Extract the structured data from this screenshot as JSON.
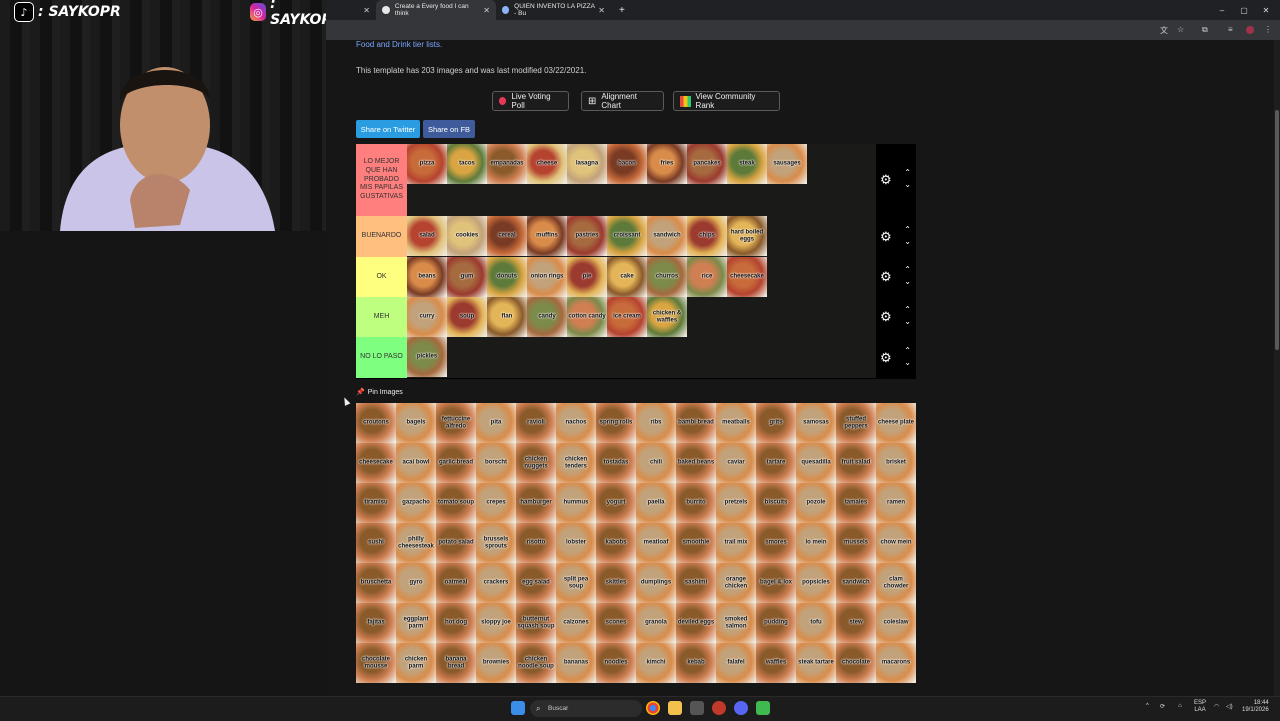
{
  "overlay": {
    "tiktok_handle": ": SAYKOPR",
    "instagram_handle": ": SAYKOPR"
  },
  "browser": {
    "tabs": [
      {
        "title": "Create a Every food I can think",
        "active": true
      },
      {
        "title": "QUIEN INVENTO LA PIZZA - Bu",
        "active": false
      }
    ],
    "new_tab": "+",
    "window_controls": [
      "–",
      "▢",
      "✕"
    ]
  },
  "page": {
    "link_line": "Food and Drink tier lists.",
    "info": "This template has 203 images and was last modified 03/22/2021.",
    "buttons": {
      "live_voting": "Live Voting Poll",
      "alignment": "Alignment Chart",
      "community": "View Community Rank"
    },
    "share_twitter": "Share on Twitter",
    "share_fb": "Share on FB",
    "pin_images": "Pin Images"
  },
  "tiers": [
    {
      "label": "LO MEJOR QUE HAN PROBADO MIS PAPILAS GUSTATIVAS",
      "color": "#ff7f7f",
      "items": [
        "pizza",
        "tacos",
        "empanadas",
        "cheese",
        "lasagna",
        "bacon",
        "fries",
        "pancakes",
        "steak",
        "sausages"
      ]
    },
    {
      "label": "BUENARDO",
      "color": "#ffbf7f",
      "items": [
        "salad",
        "cookies",
        "cereal",
        "muffins",
        "pastries",
        "croissant",
        "sandwich",
        "chips",
        "hard boiled eggs"
      ]
    },
    {
      "label": "OK",
      "color": "#ffff7f",
      "items": [
        "beans",
        "gum",
        "donuts",
        "onion rings",
        "pie",
        "cake",
        "churros",
        "rice",
        "cheesecake"
      ]
    },
    {
      "label": "MEH",
      "color": "#bfff7f",
      "items": [
        "curry",
        "soup",
        "flan",
        "candy",
        "cotton candy",
        "ice cream",
        "chicken & waffles"
      ]
    },
    {
      "label": "NO LO PASO",
      "color": "#7fff7f",
      "items": [
        "pickles"
      ]
    }
  ],
  "pool": [
    "croutons",
    "bagels",
    "fettuccine alfredo",
    "pita",
    "ravioli",
    "nachos",
    "spring rolls",
    "ribs",
    "bambi bread",
    "meatballs",
    "grits",
    "samosas",
    "stuffed peppers",
    "cheese plate",
    "cheesecake",
    "acai bowl",
    "garlic bread",
    "borscht",
    "chicken nuggets",
    "chicken tenders",
    "tostadas",
    "chili",
    "baked beans",
    "caviar",
    "tartare",
    "quesadilla",
    "fruit salad",
    "brisket",
    "tiramisu",
    "gazpacho",
    "tomato soup",
    "crepes",
    "hamburger",
    "hummus",
    "yogurt",
    "paella",
    "burrito",
    "pretzels",
    "biscuits",
    "pozole",
    "tamales",
    "ramen",
    "sushi",
    "philly cheesesteak",
    "potato salad",
    "brussels sprouts",
    "risotto",
    "lobster",
    "kabobs",
    "meatloaf",
    "smoothie",
    "trail mix",
    "smores",
    "lo mein",
    "mussels",
    "chow mein",
    "bruschetta",
    "gyro",
    "oatmeal",
    "crackers",
    "egg salad",
    "split pea soup",
    "skittles",
    "dumplings",
    "sashimi",
    "orange chicken",
    "bagel & lox",
    "popsicles",
    "sandwich",
    "clam chowder",
    "fajitas",
    "eggplant parm",
    "hot dog",
    "sloppy joe",
    "butternut squash soup",
    "calzones",
    "scones",
    "granola",
    "deviled eggs",
    "smoked salmon",
    "pudding",
    "tofu",
    "stew",
    "coleslaw",
    "chocolate mousse",
    "chicken parm",
    "banana bread",
    "brownies",
    "chicken noodle soup",
    "bananas",
    "noodles",
    "kimchi",
    "kebab",
    "falafel",
    "waffles",
    "steak tartare",
    "chocolate",
    "macarons"
  ]
}
